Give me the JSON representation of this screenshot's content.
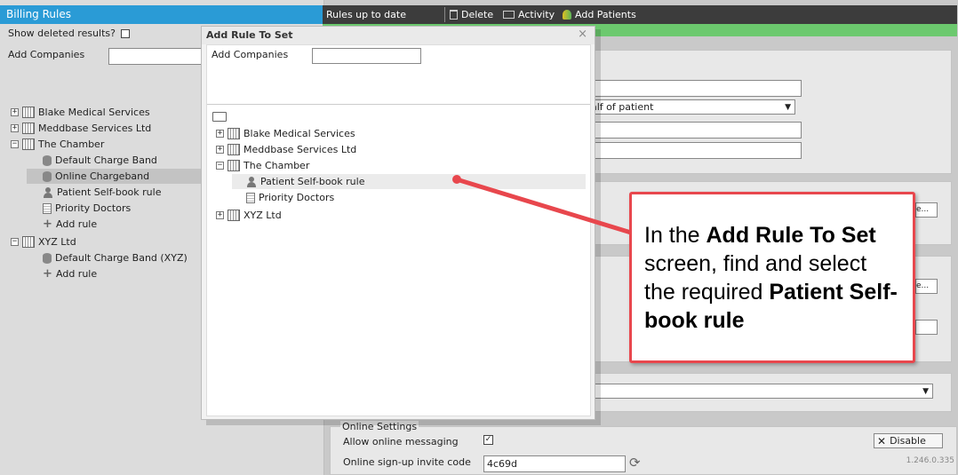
{
  "left": {
    "title": "Billing Rules",
    "show_deleted_label": "Show deleted results?",
    "add_companies_label": "Add Companies",
    "tree": [
      {
        "label": "Blake Medical Services"
      },
      {
        "label": "Meddbase Services Ltd"
      },
      {
        "label": "The Chamber"
      },
      {
        "label": "Default Charge Band"
      },
      {
        "label": "Online Chargeband"
      },
      {
        "label": "Patient Self-book rule"
      },
      {
        "label": "Priority Doctors"
      },
      {
        "label": "Add rule"
      },
      {
        "label": "XYZ Ltd"
      },
      {
        "label": "Default Charge Band (XYZ)"
      },
      {
        "label": "Add rule"
      }
    ]
  },
  "toolbar": {
    "status": "Rules up to date",
    "delete_label": "Delete",
    "activity_label": "Activity",
    "add_patients_label": "Add Patients"
  },
  "form": {
    "select_partial": "alf of patient",
    "online_settings_label": "Online Settings",
    "allow_messaging_label": "Allow online messaging",
    "invite_code_label": "Online sign-up invite code",
    "invite_code_value": "4c69d",
    "disable_label": "Disable",
    "button_partial": "e...",
    "version": "1.246.0.335"
  },
  "dialog": {
    "title": "Add Rule To Set",
    "close": "×",
    "add_companies_label": "Add Companies",
    "tree": [
      {
        "label": "Blake Medical Services"
      },
      {
        "label": "Meddbase Services Ltd"
      },
      {
        "label": "The Chamber"
      },
      {
        "label": "Patient Self-book rule"
      },
      {
        "label": "Priority Doctors"
      },
      {
        "label": "XYZ Ltd"
      }
    ]
  },
  "callout": {
    "p1": "In the ",
    "b1": "Add Rule To Set",
    "p2": " screen, find and select the required ",
    "b2": "Patient Self-book rule"
  },
  "colors": {
    "title_bar": "#2a9bd6",
    "toolbar": "#3c3c3c",
    "status_bar": "#6cc96e",
    "callout_border": "#e8474d"
  }
}
